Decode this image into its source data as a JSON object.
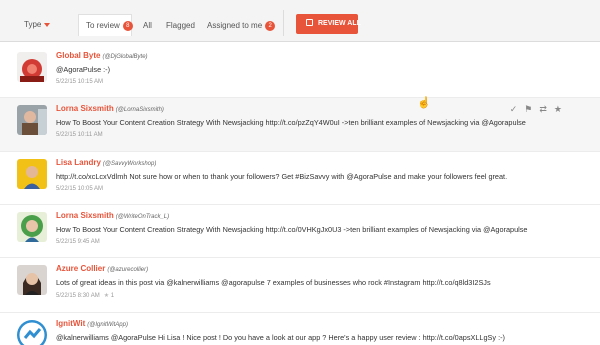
{
  "toolbar": {
    "type_label": "Type",
    "to_review_label": "To review",
    "to_review_count": "8",
    "all_label": "All",
    "flagged_label": "Flagged",
    "assigned_label": "Assigned to me",
    "assigned_count": "2",
    "review_all_label": "REVIEW ALL"
  },
  "colors": {
    "accent": "#e8543a",
    "hover_row": "#f6f6f6"
  },
  "posts": [
    {
      "name": "Global Byte",
      "handle": "(@DjGlobalByte)",
      "text": "@AgoraPulse :-)",
      "time": "5/22/15 10:15 AM",
      "stars": ""
    },
    {
      "name": "Lorna Sixsmith",
      "handle": "(@LornaSixsmith)",
      "text": "How To Boost Your Content Creation Strategy With Newsjacking http://t.co/pzZqY4W0uI ->ten brilliant examples of Newsjacking via @Agorapulse",
      "time": "5/22/15 10:11 AM",
      "stars": ""
    },
    {
      "name": "Lisa Landry",
      "handle": "(@SavvyWorkshop)",
      "text": "http://t.co/xcLcxVdlmh Not sure how or when to thank your followers? Get #BizSavvy with @AgoraPulse and make your followers feel great.",
      "time": "5/22/15 10:05 AM",
      "stars": ""
    },
    {
      "name": "Lorna Sixsmith",
      "handle": "(@WriteOnTrack_L)",
      "text": "How To Boost Your Content Creation Strategy With Newsjacking http://t.co/0VHKgJx0U3 ->ten brilliant examples of Newsjacking via @Agorapulse",
      "time": "5/22/15 9:45 AM",
      "stars": ""
    },
    {
      "name": "Azure Collier",
      "handle": "(@azurecollier)",
      "text": "Lots of great ideas in this post via @kalnerwilliams @agorapulse 7 examples of businesses who rock #Instagram http://t.co/q8ld3I2SJs",
      "time": "5/22/15 8:30 AM",
      "stars": "1"
    },
    {
      "name": "IgnitWit",
      "handle": "(@IgnitWitApp)",
      "text": "@kalnerwilliams @AgoraPulse Hi Lisa ! Nice post ! Do you have a look at our app ? Here's a happy user review : http://t.co/0apsXLLgSy :-)",
      "time": "",
      "stars": ""
    }
  ],
  "actions": {
    "check_icon": "check-icon",
    "flag_icon": "flag-icon",
    "retweet_icon": "retweet-icon",
    "star_icon": "star-icon"
  }
}
